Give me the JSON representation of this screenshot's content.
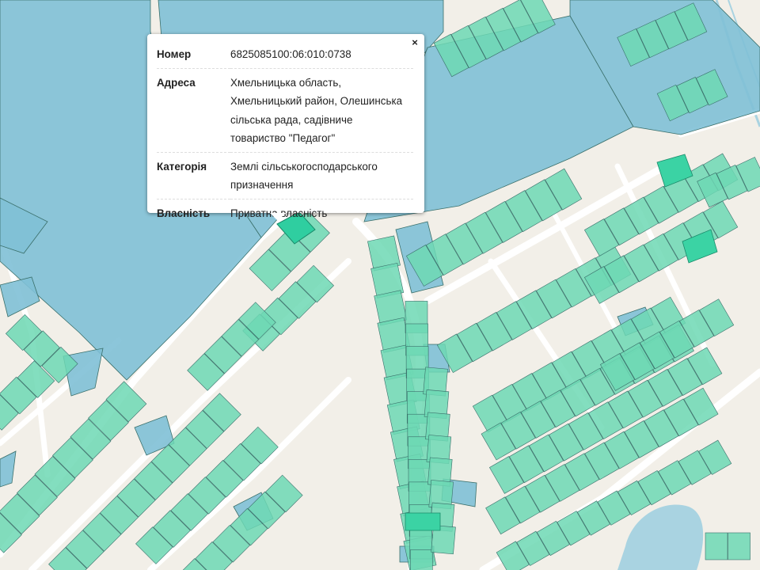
{
  "popup": {
    "close_label": "×",
    "rows": [
      {
        "label": "Номер",
        "value": "6825085100:06:010:0738"
      },
      {
        "label": "Адреса",
        "value": "Хмельницька область, Хмельницький район, Олешинська сільська рада, садівниче товариство \"Педагог\""
      },
      {
        "label": "Категорія",
        "value": "Землі сільськогосподарського призначення"
      },
      {
        "label": "Власність",
        "value": "Приватна власність"
      }
    ]
  },
  "map": {
    "colors": {
      "background": "#f2efe8",
      "road": "#ffffff",
      "parcel_private": "#6dd8b4",
      "parcel_state": "#7fc0d6",
      "parcel_selected": "#2fcea0",
      "water": "#a9d3e1",
      "parcel_border": "#3a6f6a"
    }
  }
}
